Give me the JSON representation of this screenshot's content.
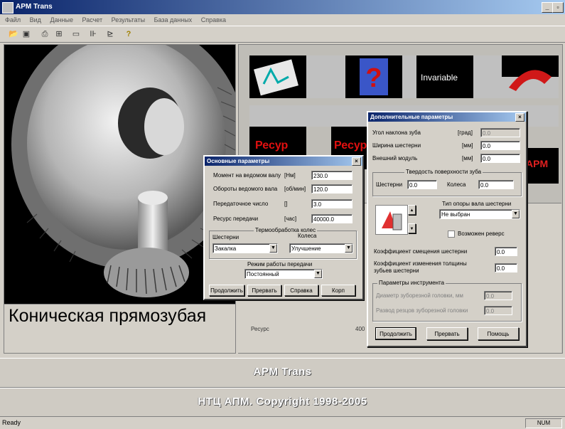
{
  "window": {
    "title": "APM Trans"
  },
  "menu": [
    "Файл",
    "Вид",
    "Данные",
    "Расчет",
    "Результаты",
    "База данных",
    "Справка"
  ],
  "toolbar": [
    {
      "icon": "open-folder-icon",
      "glyph": "📂"
    },
    {
      "icon": "save-disk-icon",
      "glyph": "▣"
    },
    {
      "icon": "print-icon",
      "glyph": "⎙"
    },
    {
      "icon": "preview-icon",
      "glyph": "⊞"
    },
    {
      "icon": "window-icon",
      "glyph": "▭"
    },
    {
      "icon": "calc-icon",
      "glyph": "⊪"
    },
    {
      "icon": "chart-icon",
      "glyph": "⊵"
    },
    {
      "icon": "help-icon",
      "glyph": "?"
    }
  ],
  "left_panel": {
    "caption": "Коническая прямозубая"
  },
  "right_panel": {
    "tiles": [
      {
        "name": "geometry-tile",
        "label": ""
      },
      {
        "name": "question-tile",
        "label": "?"
      },
      {
        "name": "invariable-tile",
        "label": "Invariable"
      },
      {
        "name": "red-gear-tile",
        "label": ""
      },
      {
        "name": "resource-tile-1",
        "label": "Ресур"
      },
      {
        "name": "resource-tile-2",
        "label": "Ресур"
      },
      {
        "name": "apm-tile",
        "label": "APM"
      }
    ],
    "lower_label": "Ресурс",
    "lower_value": "400"
  },
  "dialog_main": {
    "title": "Основные параметры",
    "fields": [
      {
        "label": "Момент на ведомом валу",
        "unit": "[Нм]",
        "value": "230.0"
      },
      {
        "label": "Обороты ведомого вала",
        "unit": "[об/мин]",
        "value": "120.0"
      },
      {
        "label": "Передаточное число",
        "unit": "[]",
        "value": "3.0"
      },
      {
        "label": "Ресурс передачи",
        "unit": "[час]",
        "value": "40000.0"
      }
    ],
    "heat_group": "Термообработка колес",
    "gear_label": "Шестерни",
    "wheel_label": "Колеса",
    "gear_select": "Закалка",
    "wheel_select": "Улучшение",
    "mode_label": "Режим работы передачи",
    "mode_select": "Постоянный",
    "buttons": [
      "Продолжить",
      "Прервать",
      "Справка",
      "Корп"
    ]
  },
  "dialog_extra": {
    "title": "Дополнительные параметры",
    "fields": [
      {
        "label": "Угол наклона зуба",
        "unit": "[град]",
        "value": "0.0",
        "disabled": true
      },
      {
        "label": "Ширина шестерни",
        "unit": "[мм]",
        "value": "0.0",
        "disabled": false
      },
      {
        "label": "Внешний модуль",
        "unit": "[мм]",
        "value": "0.0",
        "disabled": false
      }
    ],
    "hardness_group": "Твердость поверхности зуба",
    "hardness_gear_label": "Шестерни",
    "hardness_gear_value": "0.0",
    "hardness_wheel_label": "Колеса",
    "hardness_wheel_value": "0.0",
    "support_label": "Тип опоры вала шестерни",
    "support_select": "Не выбран",
    "reverse_label": "Возможен реверс",
    "shift_label": "Коэффициент смещения шестерни",
    "shift_value": "0.0",
    "thickness_label": "Коэффициент изменения толщины зубьев шестерни",
    "thickness_value": "0.0",
    "tool_group": "Параметры инструмента",
    "tool_diameter_label": "Диаметр зуборезной головки, мм",
    "tool_diameter_value": "0.0",
    "tool_cut_label": "Развод резцов зуборезной головки",
    "tool_cut_value": "0.0",
    "buttons": [
      "Продолжить",
      "Прервать",
      "Помощь"
    ]
  },
  "banners": {
    "app": "APM Trans",
    "copyright": "НТЦ АПМ. Copyright 1998-2005"
  },
  "status": {
    "left": "Ready",
    "right": "NUM"
  }
}
